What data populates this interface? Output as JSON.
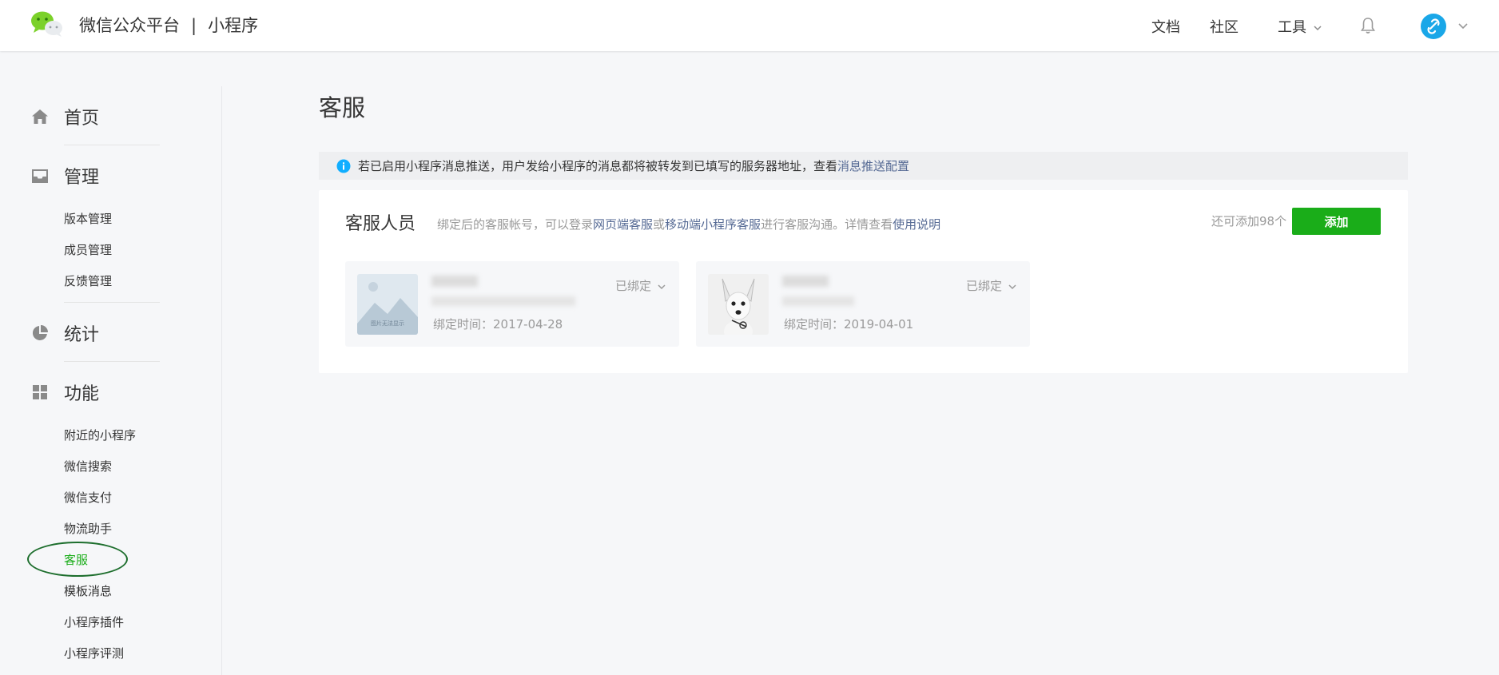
{
  "header": {
    "brand": "微信公众平台",
    "separator": "|",
    "product": "小程序",
    "nav": {
      "docs": "文档",
      "community": "社区",
      "tools": "工具"
    }
  },
  "sidebar": {
    "home": "首页",
    "manage": {
      "label": "管理",
      "items": [
        "版本管理",
        "成员管理",
        "反馈管理"
      ]
    },
    "stats": "统计",
    "features": {
      "label": "功能",
      "items": [
        "附近的小程序",
        "微信搜索",
        "微信支付",
        "物流助手",
        "客服",
        "模板消息",
        "小程序插件",
        "小程序评测"
      ],
      "active": "客服"
    }
  },
  "main": {
    "title": "客服",
    "notice": {
      "text": "若已启用小程序消息推送，用户发给小程序的消息都将被转发到已填写的服务器地址，查看",
      "link": "消息推送配置"
    },
    "card": {
      "title": "客服人员",
      "desc_prefix": "绑定后的客服帐号，可以登录",
      "desc_link1": "网页端客服",
      "desc_or": "或",
      "desc_link2": "移动端小程序客服",
      "desc_mid": "进行客服沟通。详情查看",
      "desc_link3": "使用说明",
      "remain": "还可添加98个",
      "add_button": "添加",
      "agents": [
        {
          "bind_time": "绑定时间：2017-04-28",
          "status": "已绑定",
          "avatar_text": "图片无法显示"
        },
        {
          "bind_time": "绑定时间：2019-04-01",
          "status": "已绑定"
        }
      ]
    }
  },
  "colors": {
    "accent_green": "#1aad19",
    "link_blue": "#576b95",
    "highlight_oval": "#1d6e2d"
  }
}
